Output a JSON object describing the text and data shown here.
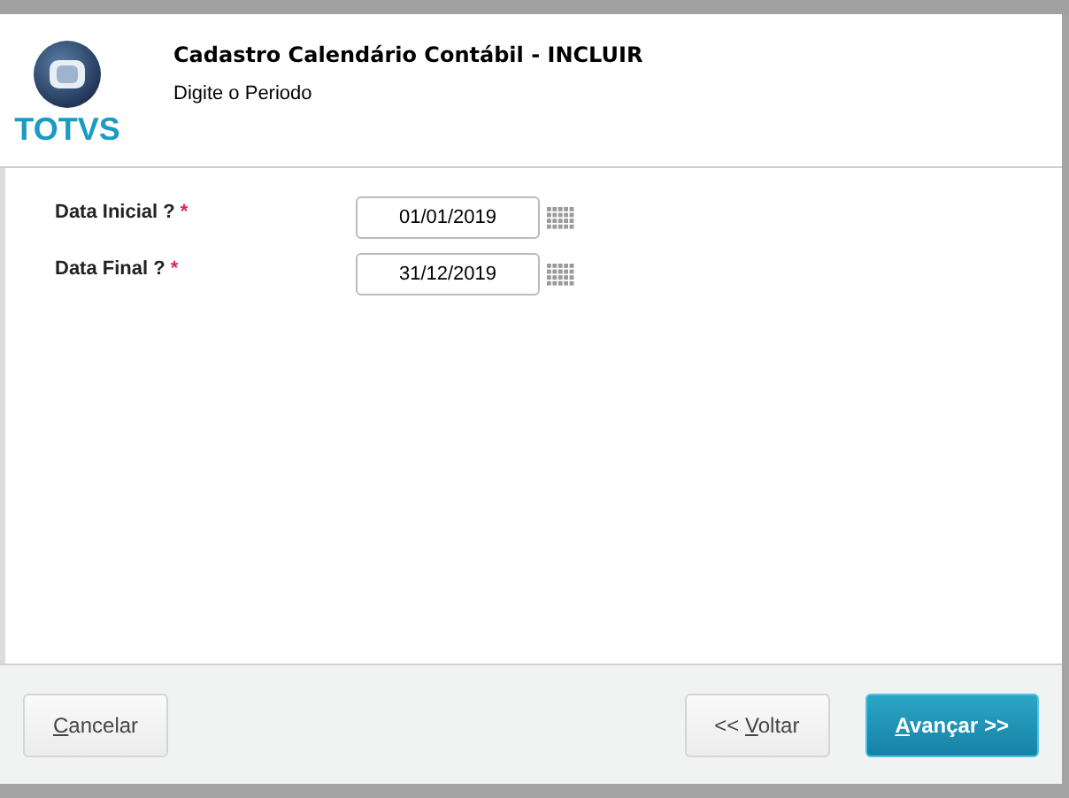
{
  "header": {
    "logo_text": "TOTVS",
    "title": "Cadastro Calendário Contábil - INCLUIR",
    "subtitle": "Digite o Periodo"
  },
  "fields": [
    {
      "label": "Data Inicial ?",
      "required_mark": "*",
      "value": "01/01/2019"
    },
    {
      "label": "Data Final ?",
      "required_mark": "*",
      "value": "31/12/2019"
    }
  ],
  "buttons": [
    {
      "kind": "plain",
      "key": "C",
      "after": "ancelar"
    },
    {
      "kind": "plain",
      "before": "<< ",
      "key": "V",
      "after": "oltar"
    },
    {
      "kind": "primary",
      "key": "A",
      "after": "vançar >>"
    }
  ]
}
